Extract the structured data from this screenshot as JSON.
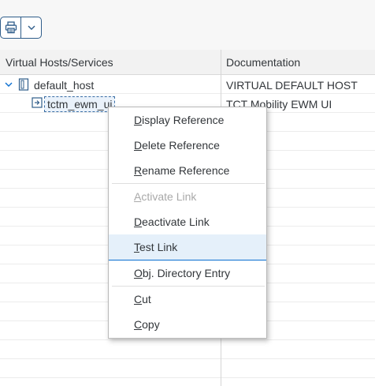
{
  "toolbar": {
    "print_icon": "printer-icon",
    "dropdown_icon": "chevron-down-icon"
  },
  "table": {
    "columns": [
      "Virtual Hosts/Services",
      "Documentation"
    ],
    "rows": [
      {
        "name": "default_host",
        "doc": "VIRTUAL DEFAULT HOST",
        "icon": "host-icon",
        "expanded": true
      },
      {
        "name": "tctm_ewm_ui",
        "doc": "TCT Mobility EWM UI",
        "icon": "service-icon"
      }
    ]
  },
  "context_menu": {
    "items": [
      {
        "mnemonic": "D",
        "rest": "isplay Reference"
      },
      {
        "mnemonic": "D",
        "rest": "elete Reference"
      },
      {
        "mnemonic": "R",
        "rest": "ename Reference"
      },
      {
        "mnemonic": "A",
        "rest": "ctivate Link",
        "disabled": true
      },
      {
        "mnemonic": "D",
        "rest": "eactivate Link"
      },
      {
        "mnemonic": "T",
        "rest": "est Link",
        "hover": true
      },
      {
        "mnemonic": "O",
        "rest": "bj. Directory Entry"
      },
      {
        "mnemonic": "C",
        "rest": "ut"
      },
      {
        "mnemonic": "C",
        "rest": "opy"
      }
    ]
  }
}
